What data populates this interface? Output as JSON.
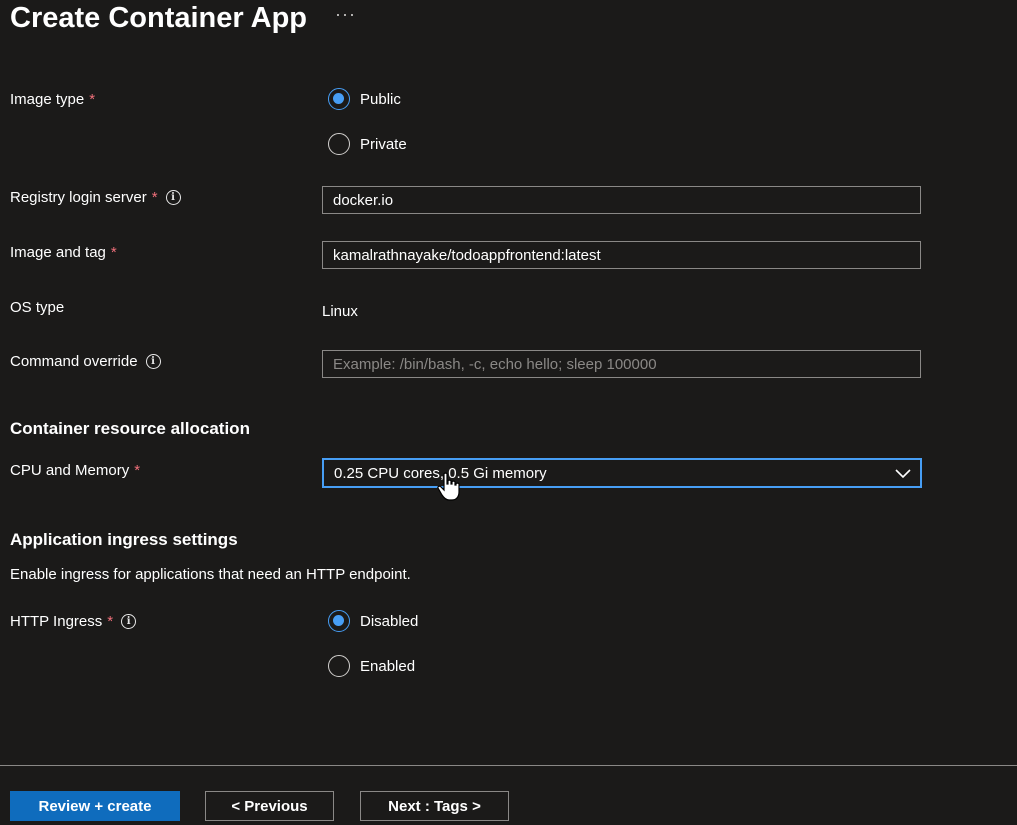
{
  "header": {
    "title": "Create Container App",
    "more_label": "···"
  },
  "image_type": {
    "label": "Image type",
    "required_mark": "*",
    "options": [
      {
        "label": "Public",
        "selected": true
      },
      {
        "label": "Private",
        "selected": false
      }
    ]
  },
  "registry": {
    "label": "Registry login server",
    "required_mark": "*",
    "value": "docker.io"
  },
  "image_tag": {
    "label": "Image and tag",
    "required_mark": "*",
    "value": "kamalrathnayake/todoappfrontend:latest"
  },
  "os_type": {
    "label": "OS type",
    "value": "Linux"
  },
  "command_override": {
    "label": "Command override",
    "value": "",
    "placeholder": "Example: /bin/bash, -c, echo hello; sleep 100000"
  },
  "resources": {
    "heading": "Container resource allocation",
    "cpu_label": "CPU and Memory",
    "required_mark": "*",
    "cpu_value": "0.25 CPU cores, 0.5 Gi memory"
  },
  "ingress": {
    "heading": "Application ingress settings",
    "description": "Enable ingress for applications that need an HTTP endpoint.",
    "label": "HTTP Ingress",
    "required_mark": "*",
    "options": [
      {
        "label": "Disabled",
        "selected": true
      },
      {
        "label": "Enabled",
        "selected": false
      }
    ]
  },
  "footer": {
    "review_label": "Review + create",
    "previous_label": "< Previous",
    "next_label": "Next : Tags >"
  },
  "colors": {
    "accent": "#479ef5",
    "primary_button": "#0f6cbd",
    "required": "#f1707b",
    "background": "#1b1a19"
  },
  "icons": [
    "more-icon",
    "info-icon",
    "chevron-down-icon",
    "hand-cursor-icon"
  ]
}
